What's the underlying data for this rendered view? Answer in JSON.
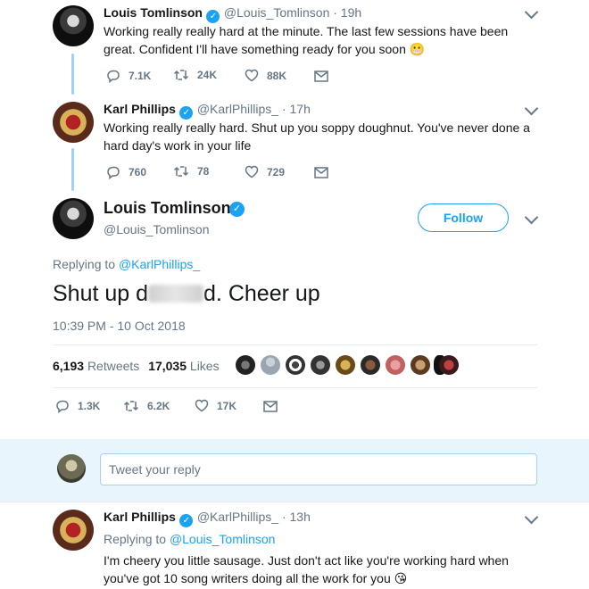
{
  "tweet1": {
    "name": "Louis Tomlinson",
    "handle": "@Louis_Tomlinson · 19h",
    "text": "Working really really hard at the minute. The last few sessions have been great. Confident I'll have something ready for you soon 😬",
    "replies": "7.1K",
    "retweets": "24K",
    "likes": "88K"
  },
  "tweet2": {
    "name": "Karl Phillips",
    "handle": "@KarlPhillips_ · 17h",
    "text": "Working really really hard. Shut up you soppy doughnut. You've never done a hard day's work in your life",
    "replies": "760",
    "retweets": "78",
    "likes": "729"
  },
  "main": {
    "name": "Louis Tomlinson",
    "handle": "@Louis_Tomlinson",
    "follow_label": "Follow",
    "replying_prefix": "Replying to ",
    "replying_to": "@KarlPhillips_",
    "text_start": "Shut up d",
    "text_end": "d. Cheer up",
    "timestamp": "10:39 PM - 10 Oct 2018",
    "retweets_count": "6,193",
    "retweets_label": "Retweets",
    "likes_count": "17,035",
    "likes_label": "Likes",
    "replies": "1.3K",
    "retweets": "6.2K",
    "likes": "17K"
  },
  "compose": {
    "placeholder": "Tweet your reply"
  },
  "reply": {
    "name": "Karl Phillips",
    "handle": "@KarlPhillips_ · 13h",
    "replying_prefix": "Replying to ",
    "replying_to": "@Louis_Tomlinson",
    "text": "I'm cheery you little sausage. Just don't act like you're working hard when you've got 10 song writers doing all the work for you 😘"
  },
  "colors": {
    "accent": "#1da1f2",
    "muted": "#657786",
    "text": "#14171a",
    "thread": "#a3d1f5"
  }
}
